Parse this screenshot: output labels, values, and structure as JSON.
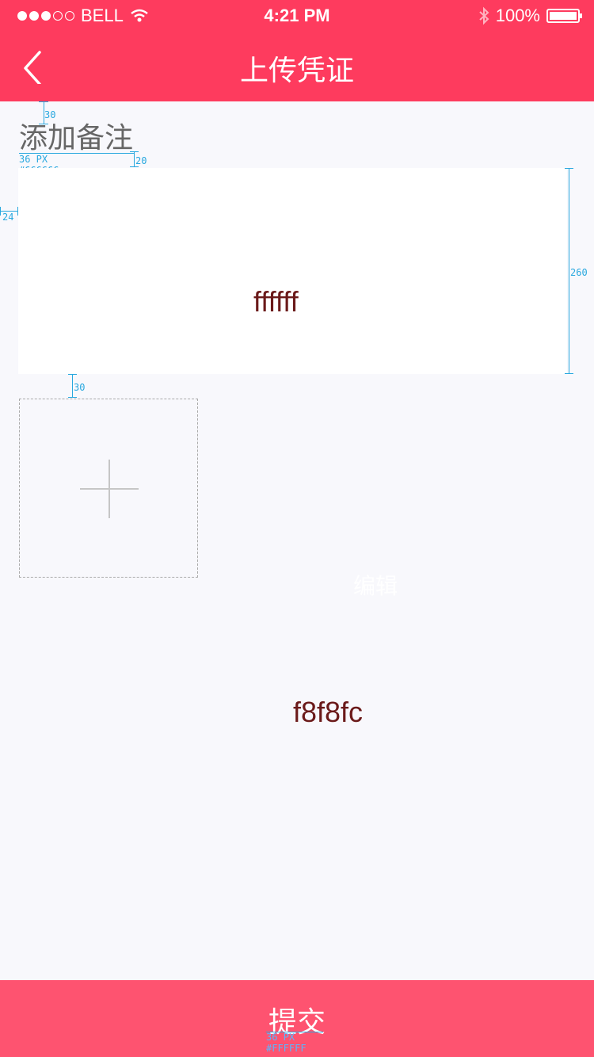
{
  "status_bar": {
    "carrier": "BELL",
    "time": "4:21 PM",
    "battery": "100%"
  },
  "nav": {
    "title": "上传凭证"
  },
  "form": {
    "label": "添加备注",
    "textbox_note": "ffffff",
    "edit_hint": "编辑",
    "bg_note": "f8f8fc",
    "submit_label": "提交"
  },
  "annotations": {
    "top_gap": "30",
    "label_size": "36 PX",
    "label_color": "#666666",
    "label_gap": "20",
    "left_margin": "24",
    "box_height": "260",
    "upload_gap": "30",
    "submit_size": "36 PX",
    "submit_color": "#FFFFFF"
  },
  "colors": {
    "brand": "#fe3b5e",
    "submit_bg": "#fe5370",
    "page_bg": "#f8f8fc",
    "label": "#666666"
  },
  "icons": {
    "back": "chevron-left-icon",
    "wifi": "wifi-icon",
    "bluetooth": "bluetooth-icon",
    "battery": "battery-icon",
    "add": "plus-icon"
  }
}
